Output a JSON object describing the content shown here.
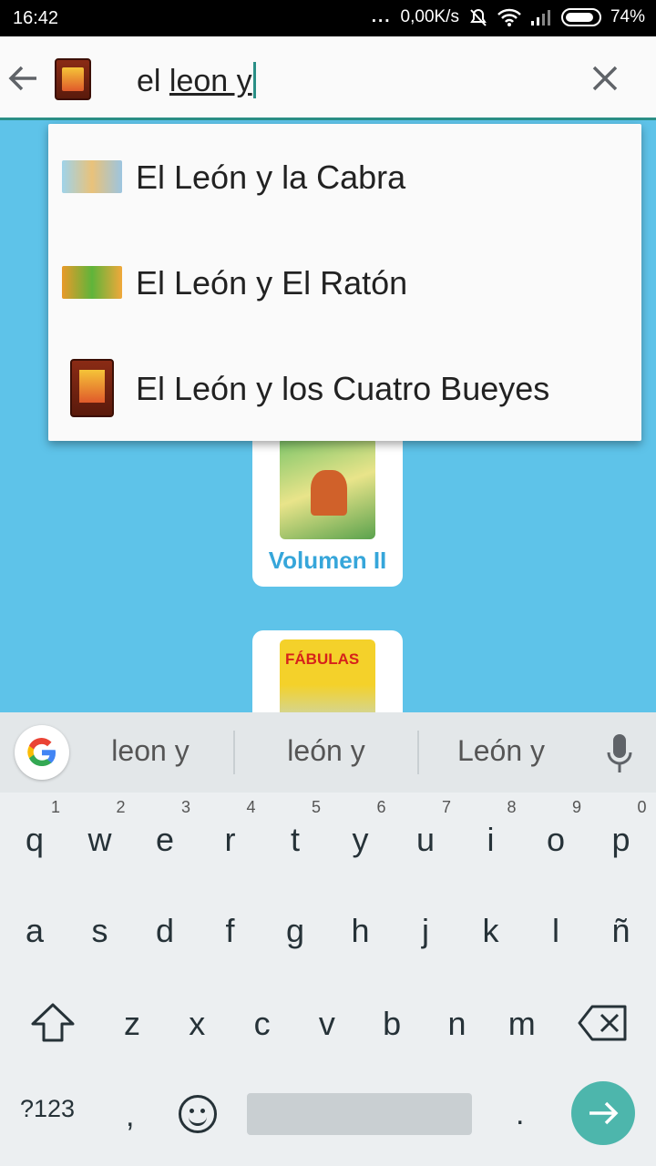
{
  "status": {
    "time": "16:42",
    "dots": "...",
    "net_speed": "0,00K/s",
    "battery": "74%"
  },
  "search": {
    "query_prefix": "el ",
    "query_composing": "leon y",
    "icons": [
      "back-arrow-icon",
      "app-icon",
      "clear-icon"
    ]
  },
  "suggestions": [
    {
      "label": "El León y la Cabra",
      "icon": "goat-thumbnail"
    },
    {
      "label": "El León y El Ratón",
      "icon": "lion-thumbnail"
    },
    {
      "label": "El León y los Cuatro Bueyes",
      "icon": "book-thumbnail"
    }
  ],
  "background": {
    "card1_label": "Volumen II",
    "card2_title": "FÁBULAS"
  },
  "keyboard": {
    "suggestions": [
      "leon y",
      "león y",
      "León y"
    ],
    "row1": [
      {
        "k": "q",
        "n": "1"
      },
      {
        "k": "w",
        "n": "2"
      },
      {
        "k": "e",
        "n": "3"
      },
      {
        "k": "r",
        "n": "4"
      },
      {
        "k": "t",
        "n": "5"
      },
      {
        "k": "y",
        "n": "6"
      },
      {
        "k": "u",
        "n": "7"
      },
      {
        "k": "i",
        "n": "8"
      },
      {
        "k": "o",
        "n": "9"
      },
      {
        "k": "p",
        "n": "0"
      }
    ],
    "row2": [
      "a",
      "s",
      "d",
      "f",
      "g",
      "h",
      "j",
      "k",
      "l",
      "ñ"
    ],
    "row3": [
      "z",
      "x",
      "c",
      "v",
      "b",
      "n",
      "m"
    ],
    "symbols_label": "?123",
    "comma": ",",
    "period": ".",
    "accent_color": "#4db6ac"
  }
}
